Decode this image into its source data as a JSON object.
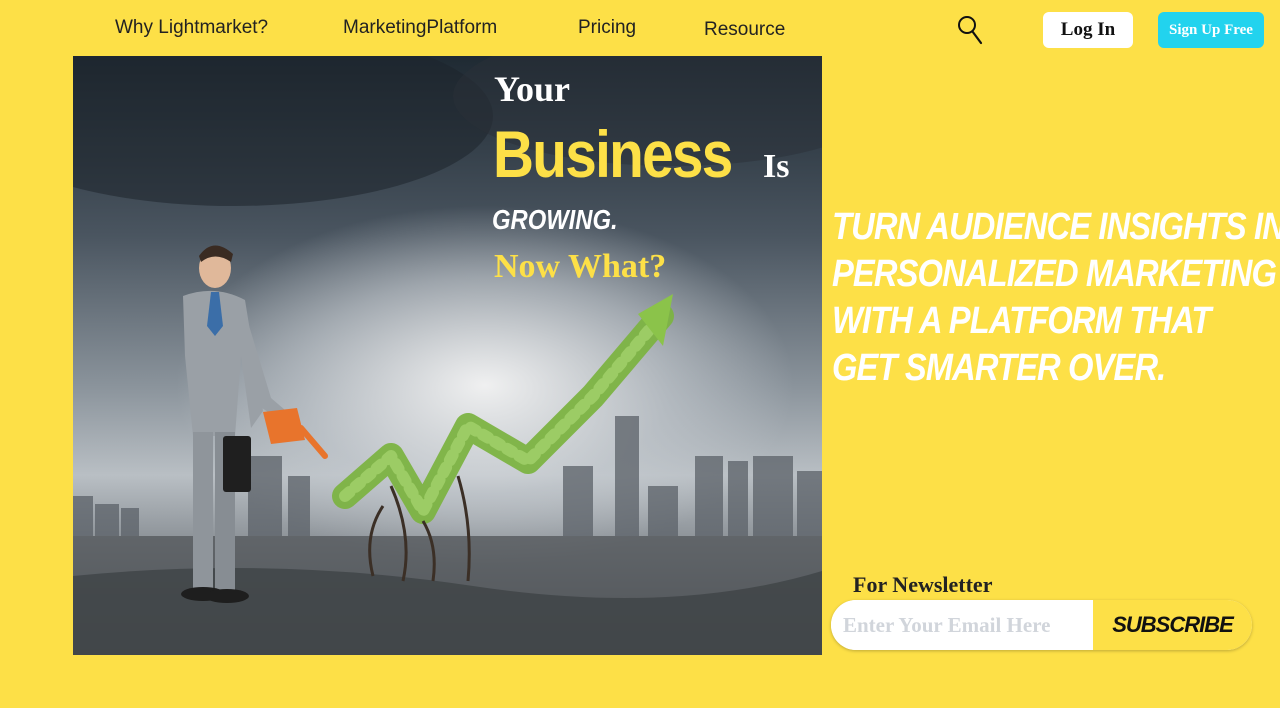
{
  "nav": {
    "links": [
      "Why Lightmarket?",
      "MarketingPlatform",
      "Pricing",
      "Resource"
    ],
    "login_label": "Log In",
    "signup_label": "Sign Up Free",
    "search_icon": "search-icon"
  },
  "hero": {
    "line1": "Your",
    "line2": "Business",
    "line2b": "Is",
    "line3": "GROWING.",
    "line4": "Now What?"
  },
  "tagline": {
    "lines": [
      "TURN AUDIENCE INSIGHTS INTO",
      "PERSONALIZED MARKETING",
      "WITH A PLATFORM THAT",
      "GET SMARTER OVER."
    ]
  },
  "newsletter": {
    "label": "For Newsletter",
    "placeholder": "Enter Your Email Here",
    "button_label": "SUBSCRIBE"
  },
  "colors": {
    "background": "#fde047",
    "signup": "#22d3ee",
    "accent_yellow": "#fde047"
  }
}
